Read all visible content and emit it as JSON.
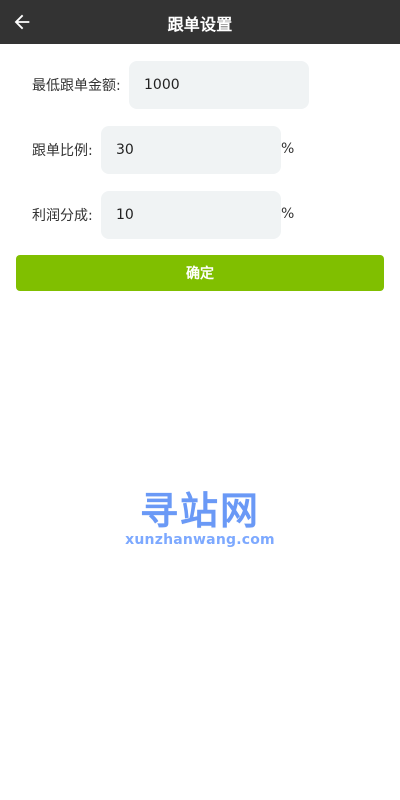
{
  "topbar": {
    "title": "跟单设置",
    "back_icon": "arrow-left-icon"
  },
  "form": {
    "min_amount": {
      "label": "最低跟单金额:",
      "value": "1000"
    },
    "ratio": {
      "label": "跟单比例:",
      "value": "30",
      "unit": "%"
    },
    "profit_share": {
      "label": "利润分成:",
      "value": "10",
      "unit": "%"
    },
    "confirm_label": "确定"
  },
  "watermark": {
    "brand": "寻站网",
    "domain": "xunzhanwang.com"
  },
  "colors": {
    "topbar_bg": "#333333",
    "field_bg": "#f0f3f4",
    "primary": "#80bf00",
    "watermark": "#5a8ff6"
  }
}
